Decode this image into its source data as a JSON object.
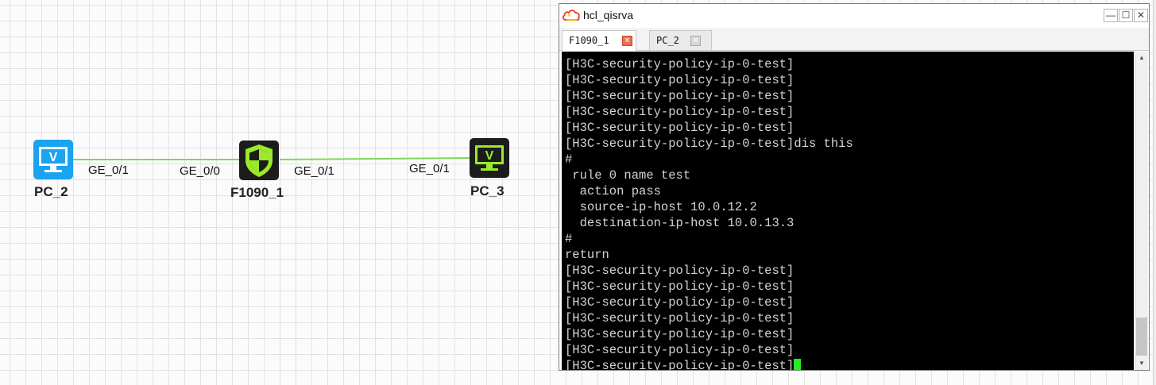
{
  "topology": {
    "devices": [
      {
        "name": "PC_2",
        "type": "pc",
        "icon": "monitor-icon"
      },
      {
        "name": "F1090_1",
        "type": "firewall",
        "icon": "shield-icon"
      },
      {
        "name": "PC_3",
        "type": "pc",
        "icon": "monitor-icon"
      }
    ],
    "links": [
      {
        "from": "PC_2",
        "from_port": "GE_0/1",
        "to": "F1090_1",
        "to_port": "GE_0/0"
      },
      {
        "from": "F1090_1",
        "from_port": "GE_0/1",
        "to": "PC_3",
        "to_port": "GE_0/1"
      }
    ],
    "link_color": "#7ed957"
  },
  "window": {
    "title": "hcl_qisrva",
    "controls": {
      "minimize": "—",
      "maximize": "☐",
      "close": "✕"
    },
    "tabs": [
      {
        "label": "F1090_1",
        "active": true
      },
      {
        "label": "PC_2",
        "active": false
      }
    ]
  },
  "terminal": {
    "lines": [
      "[H3C-security-policy-ip-0-test]",
      "[H3C-security-policy-ip-0-test]",
      "[H3C-security-policy-ip-0-test]",
      "[H3C-security-policy-ip-0-test]",
      "[H3C-security-policy-ip-0-test]",
      "[H3C-security-policy-ip-0-test]dis this",
      "#",
      " rule 0 name test",
      "  action pass",
      "  source-ip-host 10.0.12.2",
      "  destination-ip-host 10.0.13.3",
      "#",
      "return",
      "[H3C-security-policy-ip-0-test]",
      "[H3C-security-policy-ip-0-test]",
      "[H3C-security-policy-ip-0-test]",
      "[H3C-security-policy-ip-0-test]",
      "[H3C-security-policy-ip-0-test]",
      "[H3C-security-policy-ip-0-test]",
      "[H3C-security-policy-ip-0-test]"
    ],
    "text_color": "#d4d4d4",
    "cursor_color": "#22ee22"
  }
}
